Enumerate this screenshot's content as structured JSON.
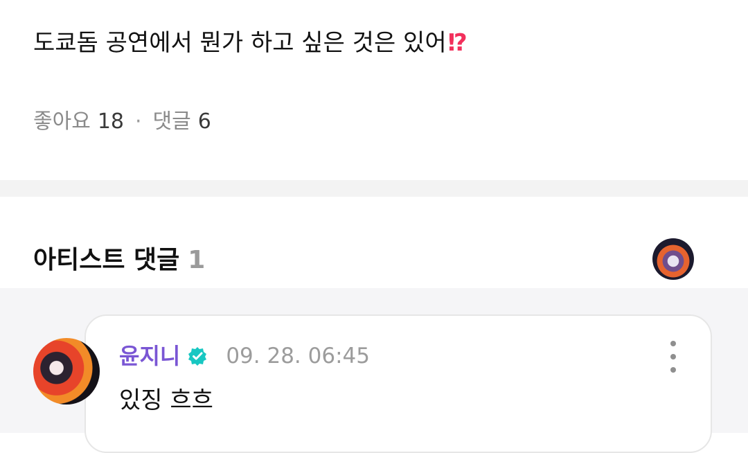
{
  "post": {
    "text": "도쿄돔 공연에서 뭔가 하고 싶은 것은 있어",
    "emoji": "⁉"
  },
  "stats": {
    "likes_label": "좋아요",
    "likes_count": "18",
    "separator": "·",
    "comments_label": "댓글",
    "comments_count": "6"
  },
  "artist_section": {
    "title": "아티스트 댓글",
    "count": "1"
  },
  "comment": {
    "author": "윤지니",
    "timestamp": "09. 28. 06:45",
    "text": "있징 흐흐",
    "more_icon": "more-vertical-icon",
    "verified_icon": "verified-badge-icon"
  },
  "colors": {
    "author": "#7a56d4",
    "verified": "#18c7c2",
    "meta": "#9c9c9c",
    "background_band": "#f3f3f3"
  }
}
